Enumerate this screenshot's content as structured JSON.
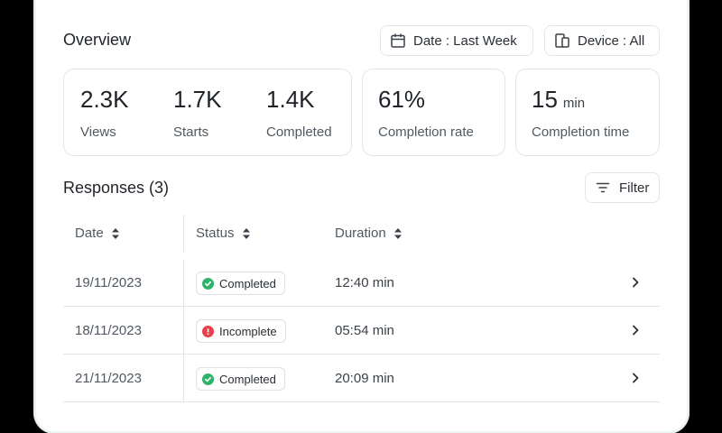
{
  "overview": {
    "title": "Overview",
    "date_filter": "Date : Last Week",
    "device_filter": "Device : All"
  },
  "stats": {
    "views": {
      "value": "2.3K",
      "label": "Views"
    },
    "starts": {
      "value": "1.7K",
      "label": "Starts"
    },
    "completed": {
      "value": "1.4K",
      "label": "Completed"
    },
    "rate": {
      "value": "61%",
      "label": "Completion rate"
    },
    "time": {
      "value": "15",
      "unit": "min",
      "label": "Completion time"
    }
  },
  "responses": {
    "title": "Responses (3)",
    "filter_label": "Filter",
    "columns": [
      "Date",
      "Status",
      "Duration"
    ],
    "rows": [
      {
        "date": "19/11/2023",
        "status": "Completed",
        "status_type": "ok",
        "duration": "12:40 min"
      },
      {
        "date": "18/11/2023",
        "status": "Incomplete",
        "status_type": "bad",
        "duration": "05:54 min"
      },
      {
        "date": "21/11/2023",
        "status": "Completed",
        "status_type": "ok",
        "duration": "20:09 min"
      }
    ]
  },
  "colors": {
    "completed_badge": "#2fb36b",
    "incomplete_badge": "#e8404c",
    "border": "#e3e5e8",
    "background": "#000000"
  }
}
